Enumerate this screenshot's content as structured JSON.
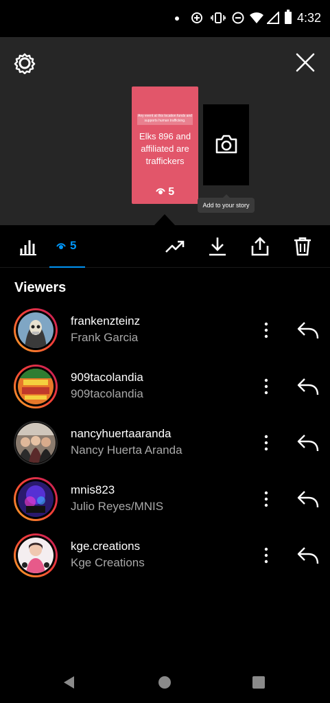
{
  "status_bar": {
    "time": "4:32",
    "icons": [
      "notification-dot-icon",
      "data-saver-icon",
      "vibrate-icon",
      "do-not-disturb-icon",
      "wifi-icon",
      "cellular-signal-icon",
      "battery-icon"
    ]
  },
  "preview": {
    "settings_icon": "gear-icon",
    "close_icon": "close-icon",
    "story": {
      "caption": "Any event at this location funds and supports human trafficking.",
      "headline": "Elks 896 and affiliated are traffickers",
      "views": "5",
      "background": "#e2566a"
    },
    "add_story_icon": "camera-icon",
    "tooltip": "Add to your story"
  },
  "toolbar": {
    "insights_icon": "bar-chart-icon",
    "views_tab_count": "5",
    "accent": "#0095f6",
    "actions": [
      "promote-trend-icon",
      "download-icon",
      "share-icon",
      "trash-icon"
    ]
  },
  "viewers": {
    "title": "Viewers",
    "items": [
      {
        "username": "frankenzteinz",
        "full_name": "Frank Garcia"
      },
      {
        "username": "909tacolandia",
        "full_name": "909tacolandia"
      },
      {
        "username": "nancyhuertaaranda",
        "full_name": "Nancy Huerta Aranda"
      },
      {
        "username": "mnis823",
        "full_name": "Julio Reyes/MNIS"
      },
      {
        "username": "kge.creations",
        "full_name": "Kge Creations"
      }
    ]
  },
  "nav": {
    "back": "back-triangle-icon",
    "home": "home-circle-icon",
    "recents": "recents-square-icon"
  }
}
